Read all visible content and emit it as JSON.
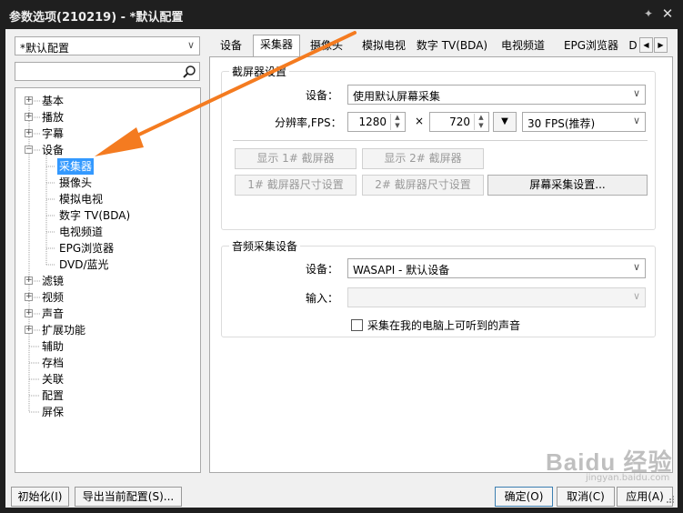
{
  "window": {
    "title": "参数选项(210219) - *默认配置"
  },
  "profile": {
    "selected": "*默认配置"
  },
  "tree": {
    "items": [
      "基本",
      "播放",
      "字幕",
      "设备",
      "采集器",
      "摄像头",
      "模拟电视",
      "数字 TV(BDA)",
      "电视频道",
      "EPG浏览器",
      "DVD/蓝光",
      "滤镜",
      "视频",
      "声音",
      "扩展功能",
      "辅助",
      "存档",
      "关联",
      "配置",
      "屏保"
    ]
  },
  "tabs": [
    "设备",
    "采集器",
    "摄像头",
    "模拟电视",
    "数字 TV(BDA)",
    "电视频道",
    "EPG浏览器",
    "D"
  ],
  "screen_capture": {
    "group_title": "截屏器设置",
    "device_label": "设备：",
    "device_value": "使用默认屏幕采集",
    "resolution_label": "分辨率,FPS：",
    "width": "1280",
    "times": "×",
    "height": "720",
    "fps": "30 FPS(推荐)",
    "show1": "显示 1# 截屏器",
    "show2": "显示 2# 截屏器",
    "size1": "1# 截屏器尺寸设置",
    "size2": "2# 截屏器尺寸设置",
    "settings": "屏幕采集设置..."
  },
  "audio_capture": {
    "group_title": "音频采集设备",
    "device_label": "设备：",
    "device_value": "WASAPI - 默认设备",
    "input_label": "输入：",
    "input_value": "",
    "loopback_label": "采集在我的电脑上可听到的声音"
  },
  "bottom": {
    "init": "初始化(I)",
    "export": "导出当前配置(S)...",
    "ok": "确定(O)",
    "cancel": "取消(C)",
    "apply": "应用(A)"
  },
  "watermark": {
    "logo": "Baidu 经验",
    "url": "jingyan.baidu.com"
  },
  "colors": {
    "accent_arrow": "#f47b20",
    "selection": "#3399ff",
    "titlebar": "#1f1f1f"
  }
}
